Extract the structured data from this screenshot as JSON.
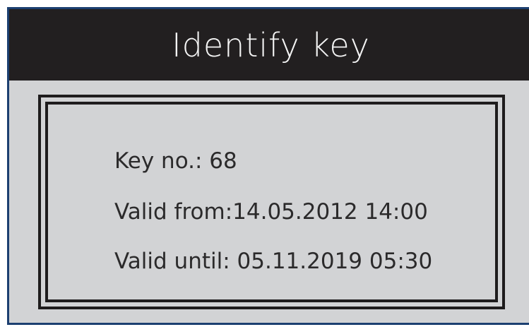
{
  "dialog": {
    "title": "Identify key",
    "key_line": "Key no.: 68",
    "valid_from_line": "Valid from:14.05.2012 14:00",
    "valid_until_line": "Valid until: 05.11.2019 05:30"
  },
  "colors": {
    "title_bar": "#221f20",
    "panel_background": "#d2d3d5",
    "frame": "#1e1c1d",
    "screen_border": "#1c3f70"
  }
}
